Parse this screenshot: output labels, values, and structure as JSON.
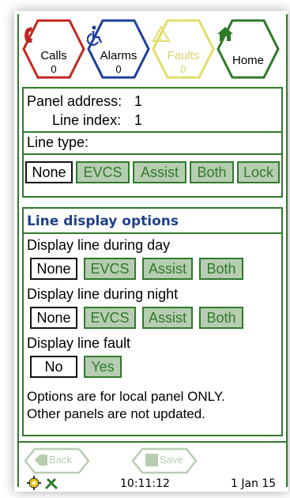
{
  "nav": {
    "calls": {
      "label": "Calls",
      "count": "0"
    },
    "alarms": {
      "label": "Alarms",
      "count": "0"
    },
    "faults": {
      "label": "Faults",
      "count": "0"
    },
    "home": {
      "label": "Home"
    }
  },
  "panel": {
    "address_label": "Panel address:",
    "address_value": "1",
    "line_index_label": "Line index:",
    "line_index_value": "1",
    "line_type_label": "Line type:",
    "line_type_options": [
      "None",
      "EVCS",
      "Assist",
      "Both",
      "Lock"
    ]
  },
  "display": {
    "title": "Line display options",
    "day_label": "Display line during day",
    "day_options": [
      "None",
      "EVCS",
      "Assist",
      "Both"
    ],
    "night_label": "Display line during night",
    "night_options": [
      "None",
      "EVCS",
      "Assist",
      "Both"
    ],
    "fault_label": "Display line fault",
    "fault_options": [
      "No",
      "Yes"
    ],
    "note_line1": "Options are for local panel ONLY.",
    "note_line2": "Other panels are not updated."
  },
  "footer": {
    "back_label": "Back",
    "save_label": "Save",
    "time": "10:11:12",
    "date": "1 Jan 15"
  },
  "colors": {
    "accent_green": "#2f7a2a",
    "calls_red": "#c0261f",
    "alarms_blue": "#1c3f9a",
    "faults_yellow": "#e2dd6a",
    "home_green": "#2f7a2a",
    "unselected_fill": "#b7cdb2"
  }
}
